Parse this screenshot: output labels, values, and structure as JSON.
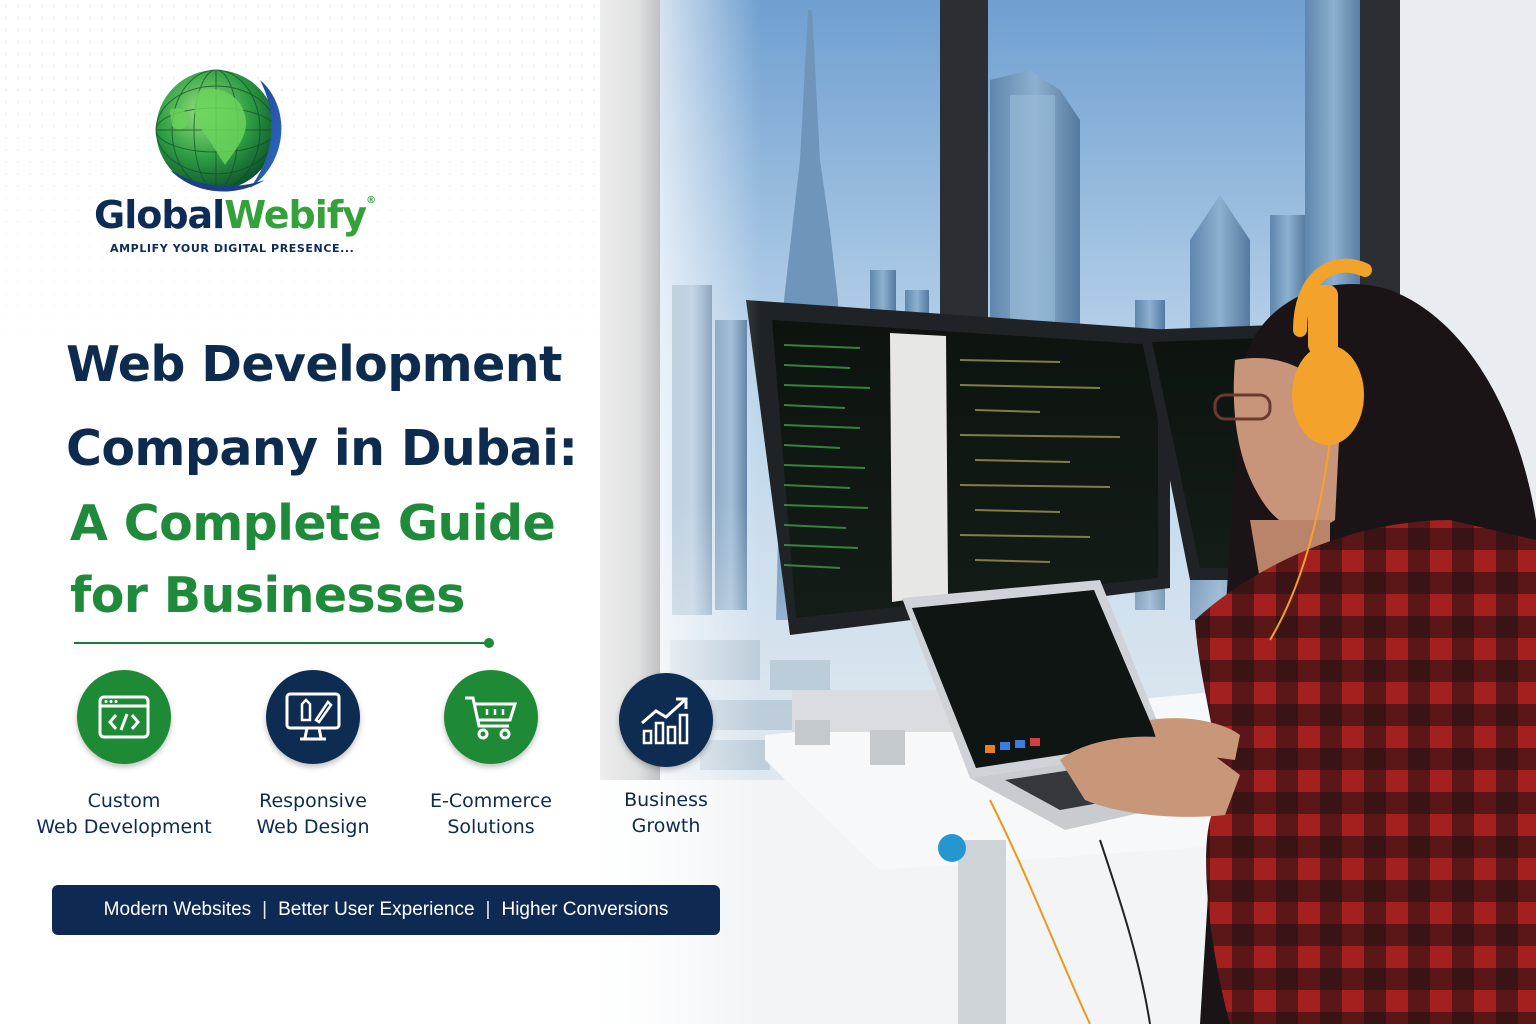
{
  "brand": {
    "name_part1": "Global",
    "name_part2": "Webify",
    "trademark": "®",
    "tagline": "AMPLIFY YOUR DIGITAL PRESENCE...",
    "colors": {
      "navy": "#0c2b55",
      "green": "#35a13b"
    }
  },
  "headline": {
    "line1": "Web Development",
    "line2": "Company in Dubai:",
    "line3": "A Complete Guide",
    "line4": "for Businesses"
  },
  "features": [
    {
      "icon": "code-window-icon",
      "line1": "Custom",
      "line2": "Web Development",
      "color": "#1f8a36"
    },
    {
      "icon": "monitor-design-icon",
      "line1": "Responsive",
      "line2": "Web Design",
      "color": "#0e2b52"
    },
    {
      "icon": "shopping-cart-icon",
      "line1": "E-Commerce",
      "line2": "Solutions",
      "color": "#1f8a36"
    },
    {
      "icon": "growth-chart-icon",
      "line1": "Business",
      "line2": "Growth",
      "color": "#0e2b52"
    }
  ],
  "benefits": {
    "item1": "Modern Websites",
    "item2": "Better User Experience",
    "item3": "Higher Conversions",
    "separator": "|"
  }
}
